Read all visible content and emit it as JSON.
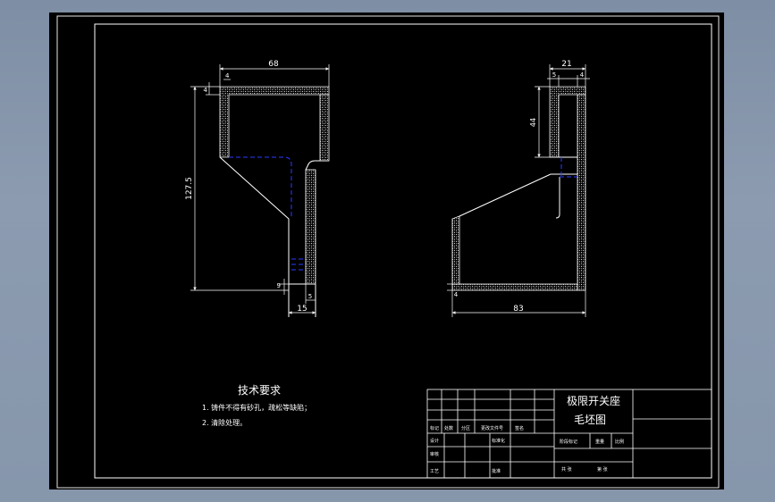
{
  "drawing": {
    "background_color": "#000000",
    "line_color": "#ffffff",
    "hidden_line_color": "#2a3cff",
    "hatch_color": "#d8d8d8",
    "front_view": {
      "dims": {
        "width": "68",
        "height": "127.5",
        "wall_top": "4",
        "wall_side": "4",
        "bottom": "9",
        "base_wall": "5",
        "base_width": "15"
      }
    },
    "side_view": {
      "dims": {
        "top_width": "21",
        "top_left": "5",
        "top_right": "4",
        "slot_height": "44",
        "bottom_left": "4",
        "length": "83"
      }
    },
    "notes": {
      "title": "技术要求",
      "items": [
        "1. 铸件不得有砂孔，疏松等缺陷；",
        "2. 清除处理。"
      ]
    },
    "title_block": {
      "part_name": "极限开关座",
      "drawing_name": "毛坯图",
      "left_header": [
        "标记",
        "处数",
        "分区",
        "更改文件号",
        "签名"
      ],
      "left_row2": [
        "设计",
        "",
        "",
        "标准化"
      ],
      "left_row3": [
        "审核"
      ],
      "left_row4": [
        "工艺",
        "",
        "批准"
      ],
      "stage_labels": [
        "阶段标记",
        "重量",
        "比例"
      ],
      "sheet_labels": [
        "共 张",
        "第 张"
      ]
    }
  }
}
